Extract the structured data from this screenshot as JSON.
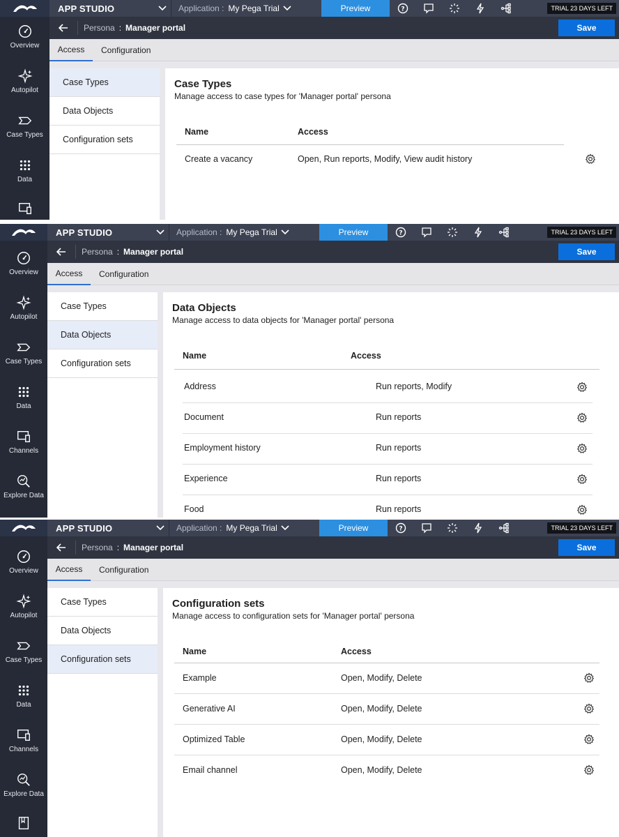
{
  "app": {
    "studio_label": "APP STUDIO",
    "application_label": "Application :",
    "application_name": "My Pega Trial",
    "preview_label": "Preview",
    "trial_label": "TRIAL 23 DAYS LEFT"
  },
  "breadcrumb": {
    "key": "Persona",
    "separator": ":",
    "value": "Manager portal"
  },
  "save_label": "Save",
  "tabs": [
    "Access",
    "Configuration"
  ],
  "subnav": [
    "Case Types",
    "Data Objects",
    "Configuration sets"
  ],
  "left_nav": [
    {
      "label": "Overview",
      "icon": "gauge-icon"
    },
    {
      "label": "Autopilot",
      "icon": "sparkle-icon"
    },
    {
      "label": "Case Types",
      "icon": "case-tag-icon"
    },
    {
      "label": "Data",
      "icon": "grid-dots-icon"
    },
    {
      "label": "Channels",
      "icon": "devices-icon"
    },
    {
      "label": "Explore Data",
      "icon": "explore-icon"
    },
    {
      "label": "",
      "icon": "book-icon"
    }
  ],
  "toolbar_icons": [
    "help-icon",
    "comment-icon",
    "loading-icon",
    "lightning-icon",
    "hierarchy-icon"
  ],
  "panel1": {
    "title": "Case Types",
    "description": "Manage access to case types for 'Manager portal' persona",
    "columns": [
      "Name",
      "Access"
    ],
    "rows": [
      {
        "name": "Create a vacancy",
        "access": "Open, Run reports, Modify, View audit history"
      }
    ]
  },
  "panel2": {
    "title": "Data Objects",
    "description": "Manage access to data objects for 'Manager portal' persona",
    "columns": [
      "Name",
      "Access"
    ],
    "rows": [
      {
        "name": "Address",
        "access": "Run reports, Modify"
      },
      {
        "name": "Document",
        "access": "Run reports"
      },
      {
        "name": "Employment history",
        "access": "Run reports"
      },
      {
        "name": "Experience",
        "access": "Run reports"
      },
      {
        "name": "Food",
        "access": "Run reports"
      }
    ]
  },
  "panel3": {
    "title": "Configuration sets",
    "description": "Manage access to configuration sets for 'Manager portal' persona",
    "columns": [
      "Name",
      "Access"
    ],
    "rows": [
      {
        "name": "Example",
        "access": "Open, Modify, Delete"
      },
      {
        "name": "Generative AI",
        "access": "Open, Modify, Delete"
      },
      {
        "name": "Optimized Table",
        "access": "Open, Modify, Delete"
      },
      {
        "name": "Email channel",
        "access": "Open, Modify, Delete"
      }
    ]
  },
  "colors": {
    "left_nav": "#252a36",
    "topbar": "#3c4252",
    "preview": "#2c8fe0",
    "save": "#0a6fdc",
    "selected_subnav": "#e6ecf8"
  }
}
